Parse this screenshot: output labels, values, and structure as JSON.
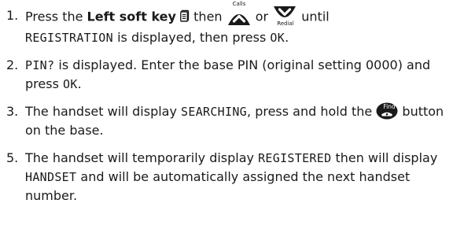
{
  "steps": [
    {
      "number": "1.",
      "t1": "Press the ",
      "t2": "Left soft key",
      "t3": " then ",
      "calls_label": "Calls",
      "t4": " or ",
      "redial_label": "Redial",
      "t5": " until",
      "t6": "REGISTRATION",
      "t7": " is displayed, then press ",
      "t8": "OK",
      "t9": "."
    },
    {
      "number": "2.",
      "t1": "PIN?",
      "t2": " is displayed. Enter the base PIN (original setting 0000) and press ",
      "t3": "OK",
      "t4": "."
    },
    {
      "number": "3.",
      "t1": "The handset will display ",
      "t2": "SEARCHING",
      "t3": ", press and hold the ",
      "find_label": "Find",
      "t4": " button on the base."
    },
    {
      "number": "5.",
      "t1": "The handset will temporarily display ",
      "t2": "REGISTERED",
      "t3": " then will display ",
      "t4": "HANDSET",
      "t5": " and will be automatically assigned the next handset number."
    }
  ],
  "colors": {
    "text": "#1a1a1a",
    "icon_fill": "#1a1a1a",
    "icon_glyph": "#ffffff"
  },
  "icons": [
    "left-soft-key-icon",
    "calls-up-icon",
    "redial-down-icon",
    "find-icon"
  ]
}
